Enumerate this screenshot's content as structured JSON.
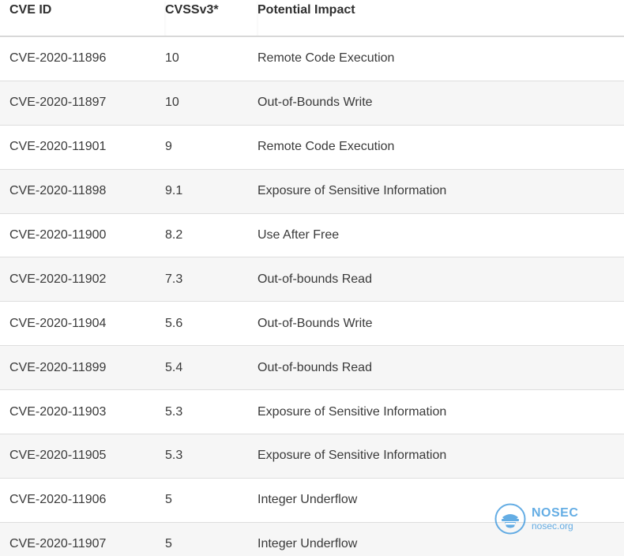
{
  "table": {
    "headers": [
      "CVE ID",
      "CVSSv3*",
      "Potential Impact"
    ],
    "rows": [
      [
        "CVE-2020-11896",
        "10",
        "Remote Code Execution"
      ],
      [
        "CVE-2020-11897",
        "10",
        "Out-of-Bounds Write"
      ],
      [
        "CVE-2020-11901",
        "9",
        "Remote Code Execution"
      ],
      [
        "CVE-2020-11898",
        "9.1",
        "Exposure of Sensitive Information"
      ],
      [
        "CVE-2020-11900",
        "8.2",
        "Use After Free"
      ],
      [
        "CVE-2020-11902",
        "7.3",
        "Out-of-bounds Read"
      ],
      [
        "CVE-2020-11904",
        "5.6",
        "Out-of-Bounds Write"
      ],
      [
        "CVE-2020-11899",
        "5.4",
        "Out-of-bounds Read"
      ],
      [
        "CVE-2020-11903",
        "5.3",
        "Exposure of Sensitive Information"
      ],
      [
        "CVE-2020-11905",
        "5.3",
        "Exposure of Sensitive Information"
      ],
      [
        "CVE-2020-11906",
        "5",
        "Integer Underflow"
      ],
      [
        "CVE-2020-11907",
        "5",
        "Integer Underflow"
      ]
    ]
  },
  "watermark": {
    "name": "NOSEC",
    "url": "nosec.org",
    "icon": "nosec-logo-icon",
    "color": "#4a9fe0"
  },
  "colors": {
    "header_text": "#2f2f2f",
    "row_alt_bg": "#f6f6f6",
    "border": "#dedede"
  }
}
